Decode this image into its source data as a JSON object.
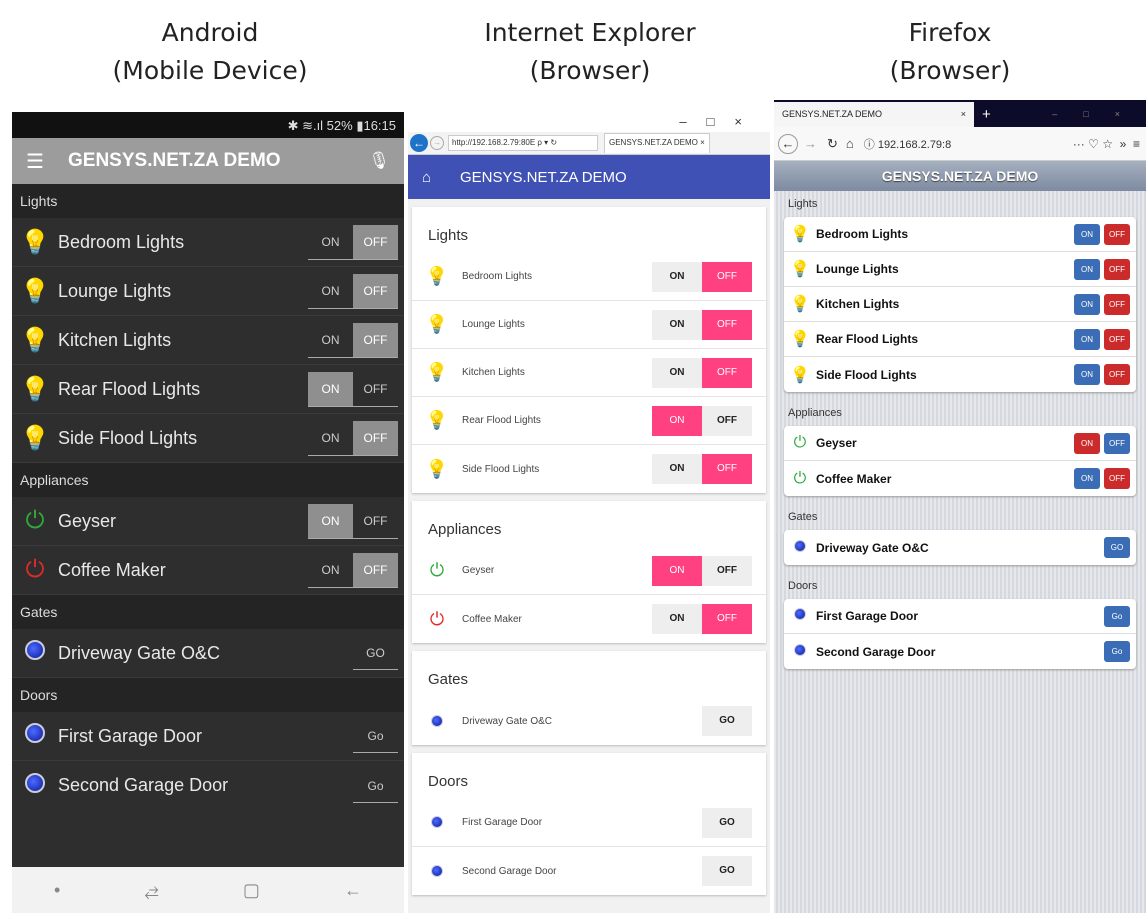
{
  "captions": {
    "android": "Android\n(Mobile Device)",
    "ie": "Internet Explorer\n(Browser)",
    "firefox": "Firefox\n(Browser)"
  },
  "colors": {
    "ie_accent": "#3f51b5",
    "ie_pink": "#ff4081",
    "ff_blue": "#3a6db5",
    "ff_red": "#cc2b2b"
  },
  "android": {
    "status": "✱ ≋.ıl 52% ▮16:15",
    "menu_icon": "hamburger-icon",
    "title": "GENSYS.NET.ZA DEMO",
    "mic_icon": "microphone-icon",
    "sections": {
      "lights": "Lights",
      "appliances": "Appliances",
      "gates": "Gates",
      "doors": "Doors"
    },
    "lights": [
      {
        "label": "Bedroom Lights",
        "state": "OFF"
      },
      {
        "label": "Lounge Lights",
        "state": "OFF"
      },
      {
        "label": "Kitchen Lights",
        "state": "OFF"
      },
      {
        "label": "Rear Flood Lights",
        "state": "ON"
      },
      {
        "label": "Side Flood Lights",
        "state": "OFF"
      }
    ],
    "appliances": [
      {
        "label": "Geyser",
        "state": "ON"
      },
      {
        "label": "Coffee Maker",
        "state": "OFF"
      }
    ],
    "gates": [
      {
        "label": "Driveway Gate O&C",
        "button": "GO"
      }
    ],
    "doors": [
      {
        "label": "First Garage Door",
        "button": "Go"
      },
      {
        "label": "Second Garage Door",
        "button": "Go"
      }
    ],
    "on_label": "ON",
    "off_label": "OFF"
  },
  "ie": {
    "window_controls": "–□×",
    "url": "http://192.168.2.79:80E ρ ▾ ↻",
    "tab": "GENSYS.NET.ZA DEMO ×",
    "title": "GENSYS.NET.ZA DEMO",
    "sections": {
      "lights": "Lights",
      "appliances": "Appliances",
      "gates": "Gates",
      "doors": "Doors"
    },
    "lights": [
      {
        "label": "Bedroom Lights",
        "state": "OFF"
      },
      {
        "label": "Lounge Lights",
        "state": "OFF"
      },
      {
        "label": "Kitchen Lights",
        "state": "OFF"
      },
      {
        "label": "Rear Flood Lights",
        "state": "ON"
      },
      {
        "label": "Side Flood Lights",
        "state": "OFF"
      }
    ],
    "appliances": [
      {
        "label": "Geyser",
        "state": "ON"
      },
      {
        "label": "Coffee Maker",
        "state": "OFF"
      }
    ],
    "gates": [
      {
        "label": "Driveway Gate O&C",
        "button": "GO"
      }
    ],
    "doors": [
      {
        "label": "First Garage Door",
        "button": "GO"
      },
      {
        "label": "Second Garage Door",
        "button": "GO"
      }
    ],
    "on_label": "ON",
    "off_label": "OFF"
  },
  "firefox": {
    "tab": "GENSYS.NET.ZA DEMO",
    "tab_close": "×",
    "new_tab": "+",
    "window_controls": "–□×",
    "url": "ⓘ 192.168.2.79:8",
    "toolbar_right": "··· ♡ ☆  »  ≡",
    "title": "GENSYS.NET.ZA DEMO",
    "sections": {
      "lights": "Lights",
      "appliances": "Appliances",
      "gates": "Gates",
      "doors": "Doors"
    },
    "lights": [
      {
        "label": "Bedroom Lights",
        "state": "OFF"
      },
      {
        "label": "Lounge Lights",
        "state": "OFF"
      },
      {
        "label": "Kitchen Lights",
        "state": "OFF"
      },
      {
        "label": "Rear Flood Lights",
        "state": "OFF"
      },
      {
        "label": "Side Flood Lights",
        "state": "OFF"
      }
    ],
    "appliances": [
      {
        "label": "Geyser",
        "state": "ON"
      },
      {
        "label": "Coffee Maker",
        "state": "OFF"
      }
    ],
    "gates": [
      {
        "label": "Driveway Gate O&C",
        "button": "GO"
      }
    ],
    "doors": [
      {
        "label": "First Garage Door",
        "button": "Go"
      },
      {
        "label": "Second Garage Door",
        "button": "Go"
      }
    ],
    "on_label": "ON",
    "off_label": "OFF"
  }
}
